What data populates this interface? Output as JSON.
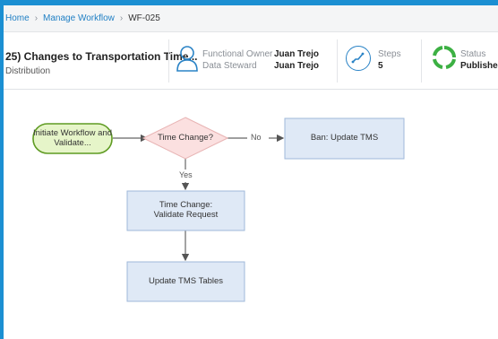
{
  "breadcrumb": {
    "home": "Home",
    "manage": "Manage Workflow",
    "current": "WF-025"
  },
  "header": {
    "title": "25) Changes to Transportation Time...",
    "subtitle": "Distribution",
    "functional_owner_label": "Functional Owner",
    "functional_owner_value": "Juan Trejo",
    "data_steward_label": "Data Steward",
    "data_steward_value": "Juan Trejo",
    "steps_label": "Steps",
    "steps_value": "5",
    "status_label": "Status",
    "status_value": "Published"
  },
  "workflow": {
    "start_node": "Initiate Workflow and Validate...",
    "decision_node": "Time Change?",
    "ban_node": "Ban: Update TMS",
    "validate_node": "Time Change: Validate Request",
    "update_node": "Update TMS Tables",
    "edge_no": "No",
    "edge_yes": "Yes"
  },
  "colors": {
    "accent": "#1b8fd2",
    "start_fill": "#e6f5c9",
    "start_border": "#5f9b22",
    "decision_fill": "#fbe0e0",
    "task_fill": "#dfe9f6",
    "task_border": "#9fb8d9",
    "status_green": "#3cb043"
  }
}
